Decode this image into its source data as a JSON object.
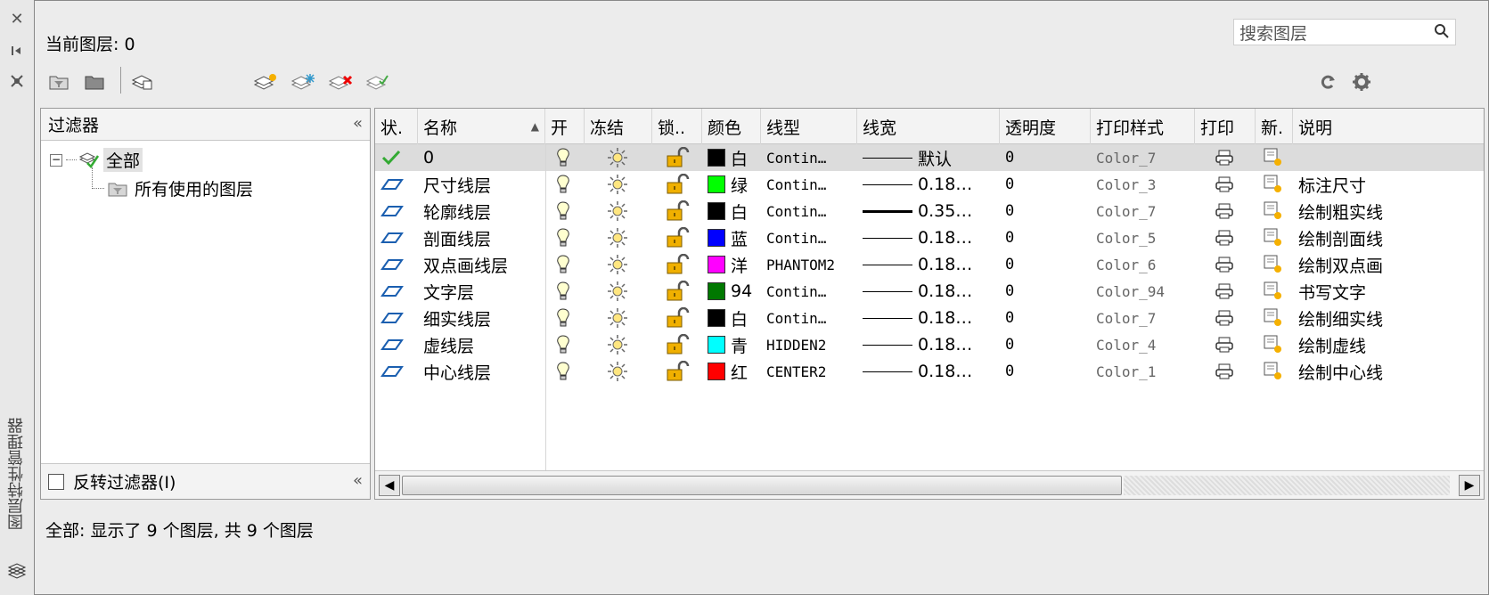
{
  "palette_title": "图层特性管理器",
  "current_layer": "当前图层: 0",
  "search_placeholder": "搜索图层",
  "filter": {
    "header": "过滤器",
    "tree_all": "全部",
    "tree_used": "所有使用的图层",
    "invert_label": "反转过滤器(I)"
  },
  "columns": [
    "状.",
    "名称",
    "开",
    "冻结",
    "锁..",
    "颜色",
    "线型",
    "线宽",
    "透明度",
    "打印样式",
    "打印",
    "新.",
    "说明"
  ],
  "layers": [
    {
      "status": "current",
      "name": "0",
      "color_hex": "#000000",
      "color_name": "白",
      "linetype": "Contin…",
      "lineweight": "默认",
      "thick": false,
      "transparency": "0",
      "plot_style": "Color_7",
      "description": ""
    },
    {
      "status": "layer",
      "name": "尺寸线层",
      "color_hex": "#00ff00",
      "color_name": "绿",
      "linetype": "Contin…",
      "lineweight": "0.18…",
      "thick": false,
      "transparency": "0",
      "plot_style": "Color_3",
      "description": "标注尺寸"
    },
    {
      "status": "layer",
      "name": "轮廓线层",
      "color_hex": "#000000",
      "color_name": "白",
      "linetype": "Contin…",
      "lineweight": "0.35…",
      "thick": true,
      "transparency": "0",
      "plot_style": "Color_7",
      "description": "绘制粗实线"
    },
    {
      "status": "layer",
      "name": "剖面线层",
      "color_hex": "#0000ff",
      "color_name": "蓝",
      "linetype": "Contin…",
      "lineweight": "0.18…",
      "thick": false,
      "transparency": "0",
      "plot_style": "Color_5",
      "description": "绘制剖面线"
    },
    {
      "status": "layer",
      "name": "双点画线层",
      "color_hex": "#ff00ff",
      "color_name": "洋",
      "linetype": "PHANTOM2",
      "lineweight": "0.18…",
      "thick": false,
      "transparency": "0",
      "plot_style": "Color_6",
      "description": "绘制双点画"
    },
    {
      "status": "layer",
      "name": "文字层",
      "color_hex": "#007800",
      "color_name": "94",
      "linetype": "Contin…",
      "lineweight": "0.18…",
      "thick": false,
      "transparency": "0",
      "plot_style": "Color_94",
      "description": "书写文字"
    },
    {
      "status": "layer",
      "name": "细实线层",
      "color_hex": "#000000",
      "color_name": "白",
      "linetype": "Contin…",
      "lineweight": "0.18…",
      "thick": false,
      "transparency": "0",
      "plot_style": "Color_7",
      "description": "绘制细实线"
    },
    {
      "status": "layer",
      "name": "虚线层",
      "color_hex": "#00ffff",
      "color_name": "青",
      "linetype": "HIDDEN2",
      "lineweight": "0.18…",
      "thick": false,
      "transparency": "0",
      "plot_style": "Color_4",
      "description": "绘制虚线"
    },
    {
      "status": "layer",
      "name": "中心线层",
      "color_hex": "#ff0000",
      "color_name": "红",
      "linetype": "CENTER2",
      "lineweight": "0.18…",
      "thick": false,
      "transparency": "0",
      "plot_style": "Color_1",
      "description": "绘制中心线"
    }
  ],
  "status_text": "全部: 显示了 9 个图层, 共 9 个图层"
}
